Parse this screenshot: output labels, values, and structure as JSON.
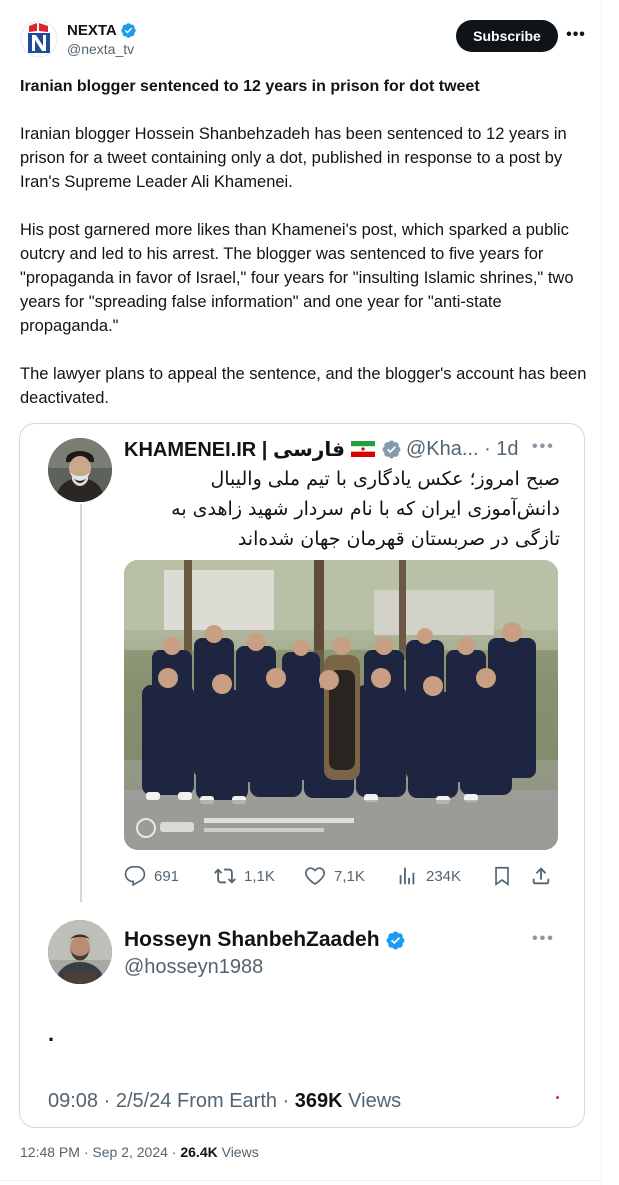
{
  "post": {
    "author_name": "NEXTA",
    "author_handle": "@nexta_tv",
    "subscribe_label": "Subscribe",
    "more_label": "•••",
    "headline": "Iranian blogger sentenced to 12 years in prison for dot tweet",
    "paragraphs": [
      "Iranian blogger Hossein Shanbehzadeh has been sentenced to 12 years in prison for a tweet containing only a dot, published in response to a post by Iran's Supreme Leader Ali Khamenei.",
      "His post garnered more likes than Khamenei's post, which sparked a public outcry and led to his arrest. The blogger was sentenced to five years for \"propaganda in favor of Israel,\" four years for \"insulting Islamic shrines,\" two years for \"spreading false information\" and one year for \"anti-state propaganda.\"",
      "The lawyer plans to appeal the sentence, and the blogger's account has been deactivated."
    ],
    "time": "12:48 PM",
    "date": "Sep 2, 2024",
    "views_count": "26.4K",
    "views_label": "Views"
  },
  "embed": {
    "khamenei": {
      "name": "KHAMENEI.IR | فارسی",
      "handle": "@Kha... · 1d",
      "text": "صبح امروز؛ عکس یادگاری با تیم ملی والیبال دانش‌آموزی ایران که با نام سردار شهید زاهدی به تازگی در صربستان قهرمان جهان شده‌اند",
      "more_label": "•••",
      "stats": {
        "replies": "691",
        "reposts": "1,1K",
        "likes": "7,1K",
        "views": "234K"
      }
    },
    "hosseyn": {
      "name": "Hosseyn ShanbehZaadeh",
      "handle": "@hosseyn1988",
      "text": ".",
      "more_label": "•••",
      "time_date": "09:08 · 2/5/24 From Earth ·",
      "views_count": "369K",
      "views_label": "Views"
    }
  },
  "colors": {
    "text": "#0f1419",
    "secondary": "#536471",
    "verified": "#1d9bf0",
    "border": "#cfd9de",
    "nexta_red": "#d7262f",
    "nexta_blue": "#1f4a9c"
  },
  "icons": {
    "reply": "reply-icon",
    "repost": "repost-icon",
    "like": "heart-icon",
    "views": "views-icon",
    "bookmark": "bookmark-icon",
    "share": "share-icon"
  }
}
